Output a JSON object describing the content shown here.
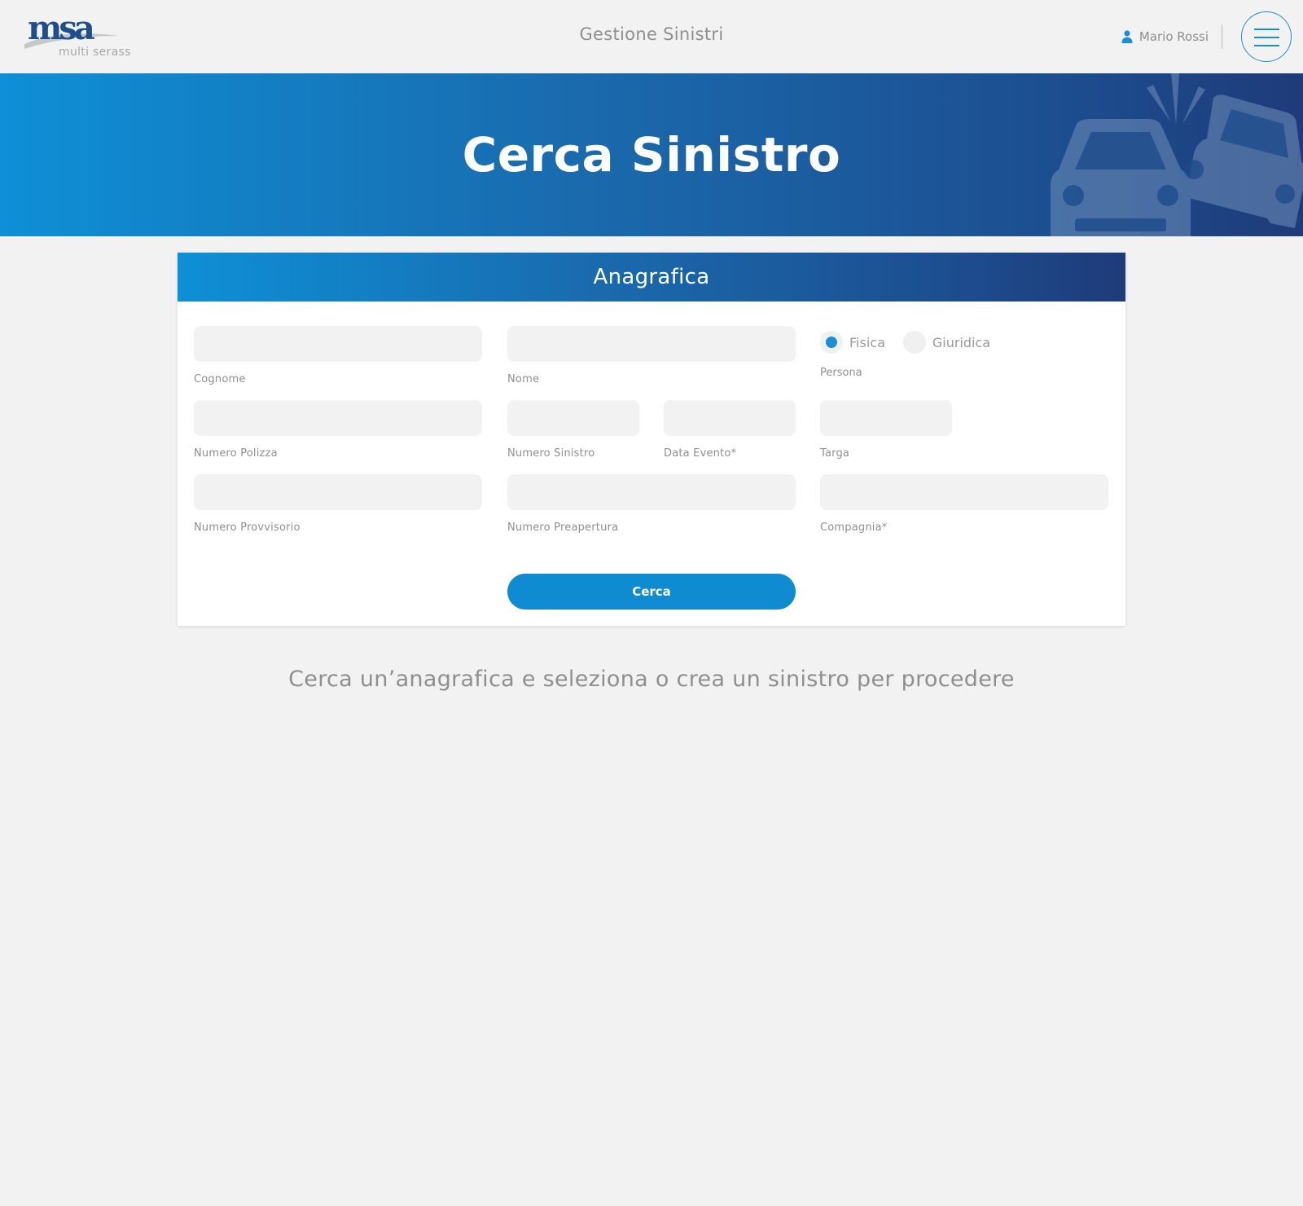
{
  "header": {
    "logo_text": "msa",
    "logo_subtext": "multi serass",
    "app_title": "Gestione Sinistri",
    "user_name": "Mario Rossi",
    "user_icon": "user-icon",
    "menu_icon": "hamburger-menu-icon"
  },
  "hero": {
    "title": "Cerca Sinistro",
    "illustration": "car-crash-icon"
  },
  "form": {
    "section_title": "Anagrafica",
    "fields": {
      "cognome": {
        "label": "Cognome",
        "value": ""
      },
      "nome": {
        "label": "Nome",
        "value": ""
      },
      "numero_polizza": {
        "label": "Numero Polizza",
        "value": ""
      },
      "numero_sinistro": {
        "label": "Numero Sinistro",
        "value": ""
      },
      "data_evento": {
        "label": "Data Evento*",
        "value": ""
      },
      "targa": {
        "label": "Targa",
        "value": ""
      },
      "numero_provvisorio": {
        "label": "Numero Provvisorio",
        "value": ""
      },
      "numero_preapertura": {
        "label": "Numero Preapertura",
        "value": ""
      },
      "compagnia": {
        "label": "Compagnia*",
        "value": ""
      }
    },
    "persona": {
      "label": "Persona",
      "options": [
        "Fisica",
        "Giuridica"
      ],
      "selected": "Fisica"
    },
    "submit_label": "Cerca"
  },
  "hint": "Cerca un’anagrafica e seleziona o crea un sinistro per procedere",
  "colors": {
    "accent": "#0f8bd2",
    "gradient_start": "#0e8fd6",
    "gradient_end": "#1f3b79",
    "background": "#f2f2f2",
    "logo_blue": "#1f4f8a"
  }
}
